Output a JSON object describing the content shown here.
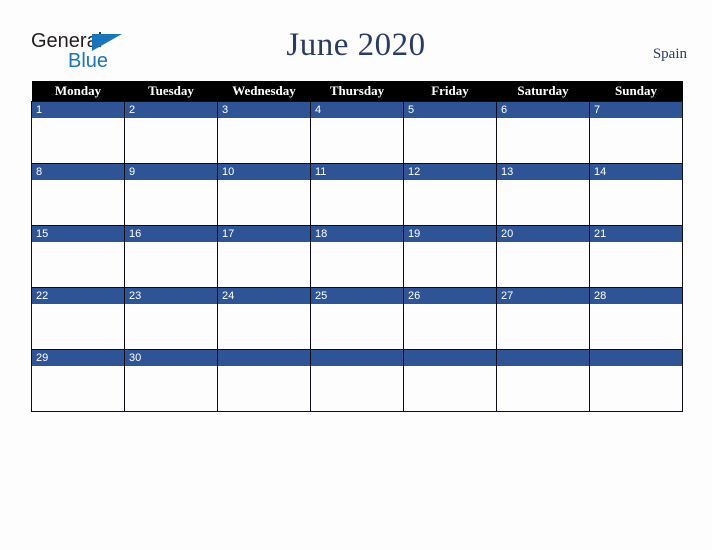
{
  "logo": {
    "line1": "General",
    "line2": "Blue",
    "triangle_icon": "triangle-icon",
    "dark_color": "#231f20",
    "blue_color": "#1b75bb"
  },
  "header": {
    "title": "June 2020",
    "country": "Spain",
    "title_color": "#2b3c63"
  },
  "calendar": {
    "weekday_headers": [
      "Monday",
      "Tuesday",
      "Wednesday",
      "Thursday",
      "Friday",
      "Saturday",
      "Sunday"
    ],
    "header_bg": "#000000",
    "header_text_color": "#ffffff",
    "day_band_color": "#2e5496",
    "day_number_color": "#ffffff",
    "cell_bg": "#fdfdfd",
    "border_color": "#0d0d1a",
    "weeks": [
      {
        "days": [
          "1",
          "2",
          "3",
          "4",
          "5",
          "6",
          "7"
        ]
      },
      {
        "days": [
          "8",
          "9",
          "10",
          "11",
          "12",
          "13",
          "14"
        ]
      },
      {
        "days": [
          "15",
          "16",
          "17",
          "18",
          "19",
          "20",
          "21"
        ]
      },
      {
        "days": [
          "22",
          "23",
          "24",
          "25",
          "26",
          "27",
          "28"
        ]
      },
      {
        "days": [
          "29",
          "30",
          "",
          "",
          "",
          "",
          ""
        ]
      }
    ]
  }
}
